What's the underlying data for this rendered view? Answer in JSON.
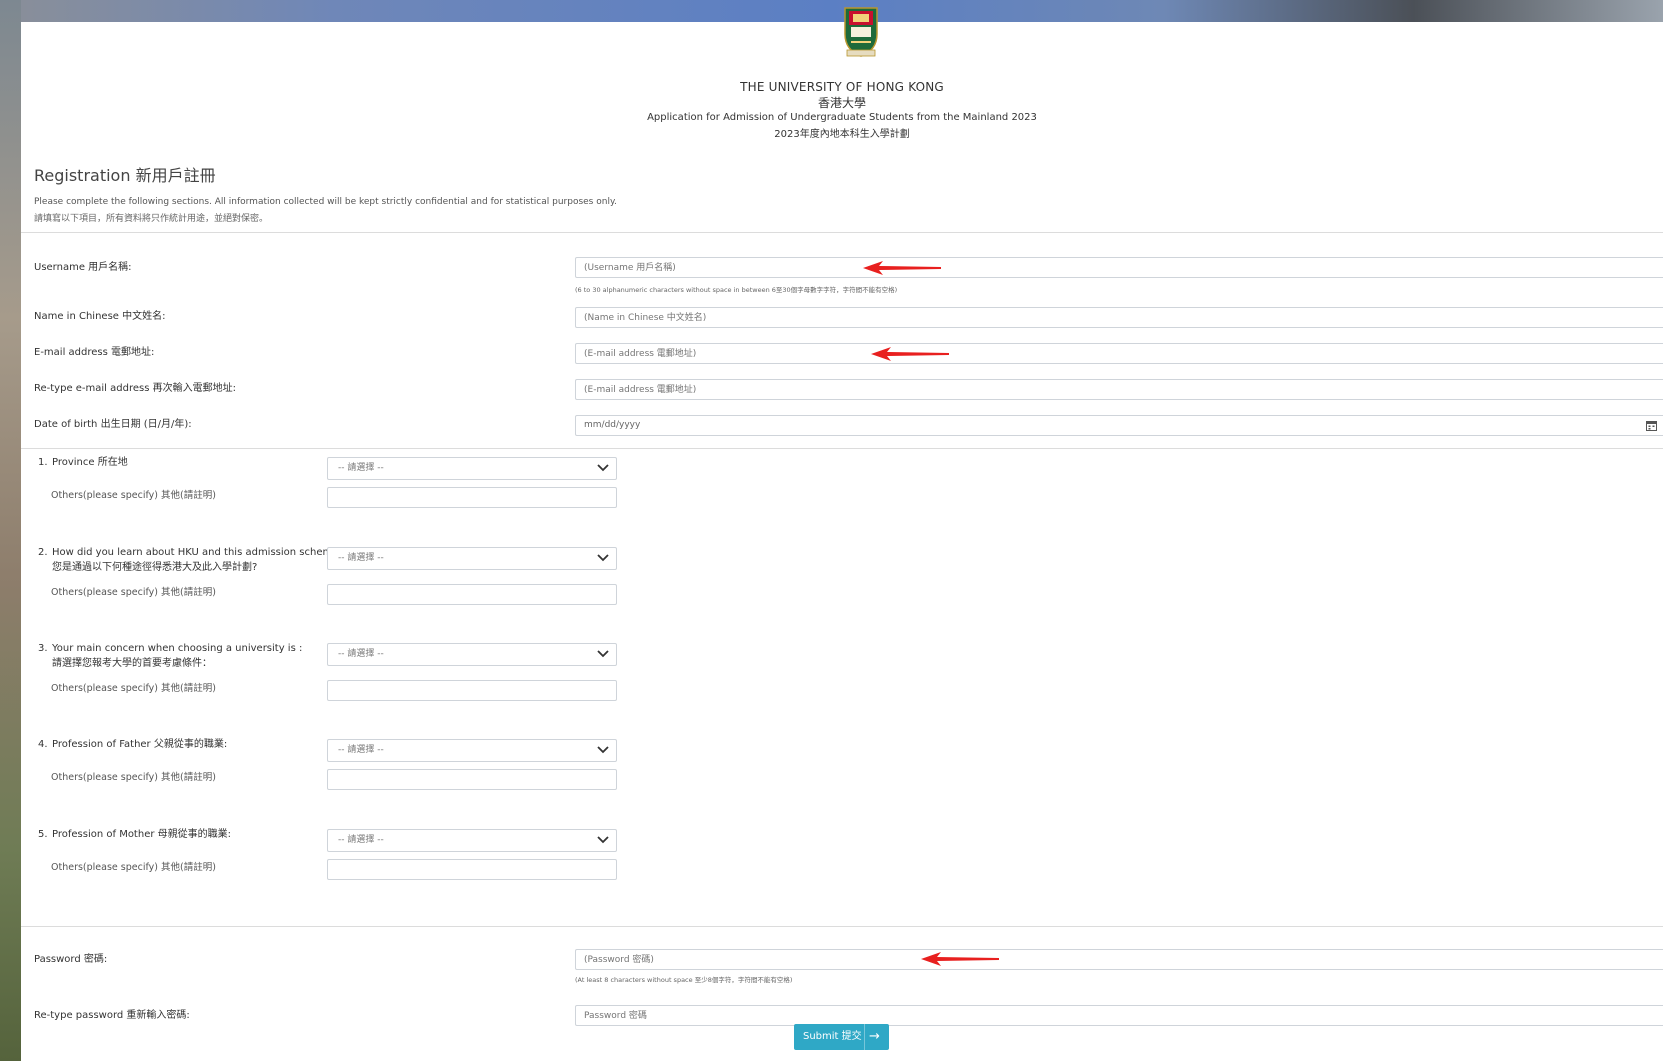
{
  "header": {
    "university_en": "THE UNIVERSITY OF HONG KONG",
    "university_zh": "香港大學",
    "program_en": "Application for Admission of Undergraduate Students from the Mainland 2023",
    "program_zh": "2023年度內地本科生入學計劃"
  },
  "registration": {
    "title": "Registration 新用戶註冊",
    "intro_en": "Please complete the following sections. All information collected will be kept strictly confidential and for statistical purposes only.",
    "intro_zh": "請填寫以下項目，所有資料將只作統計用途，並絕對保密。"
  },
  "fields": {
    "username": {
      "label": "Username 用戶名稱:",
      "placeholder": "(Username 用戶名稱)",
      "hint": "(6 to 30 alphanumeric characters without space in between 6至30個字母數字字符，字符間不能有空格)"
    },
    "name_cn": {
      "label": "Name in Chinese 中文姓名:",
      "placeholder": "(Name in Chinese 中文姓名)"
    },
    "email": {
      "label": "E-mail address 電郵地址:",
      "placeholder": "(E-mail address 電郵地址)"
    },
    "email_retype": {
      "label": "Re-type e-mail address 再次輸入電郵地址:",
      "placeholder": "(E-mail address 電郵地址)"
    },
    "dob": {
      "label": "Date of birth 出生日期 (日/月/年):",
      "placeholder": "mm/dd/yyyy"
    },
    "password": {
      "label": "Password 密碼:",
      "placeholder": "(Password 密碼)",
      "hint": "(At least 8 characters without space 至少8個字符，字符間不能有空格)"
    },
    "password_retype": {
      "label": "Re-type password 重新輸入密碼:",
      "placeholder": "Password 密碼"
    }
  },
  "questions": [
    {
      "num": "1.",
      "label": "Province 所在地",
      "label2": "",
      "select": "-- 請選擇 --",
      "others": "Others(please specify) 其他(請註明)"
    },
    {
      "num": "2.",
      "label": "How did you learn about HKU and this admission scheme?",
      "label2": "您是通過以下何種途徑得悉港大及此入學計劃?",
      "select": "-- 請選擇 --",
      "others": "Others(please specify) 其他(請註明)"
    },
    {
      "num": "3.",
      "label": "Your main concern when choosing a university is :",
      "label2": "請選擇您報考大學的首要考慮條件：",
      "select": "-- 請選擇 --",
      "others": "Others(please specify) 其他(請註明)"
    },
    {
      "num": "4.",
      "label": "Profession of Father 父親從事的職業:",
      "label2": "",
      "select": "-- 請選擇 --",
      "others": "Others(please specify) 其他(請註明)"
    },
    {
      "num": "5.",
      "label": "Profession of Mother 母親從事的職業:",
      "label2": "",
      "select": "-- 請選擇 --",
      "others": "Others(please specify) 其他(請註明)"
    }
  ],
  "submit": {
    "label": "Submit 提交",
    "icon": "arrow-right-icon"
  },
  "colors": {
    "accent": "#2fa8c6",
    "annotation_arrow": "#e8201f"
  }
}
